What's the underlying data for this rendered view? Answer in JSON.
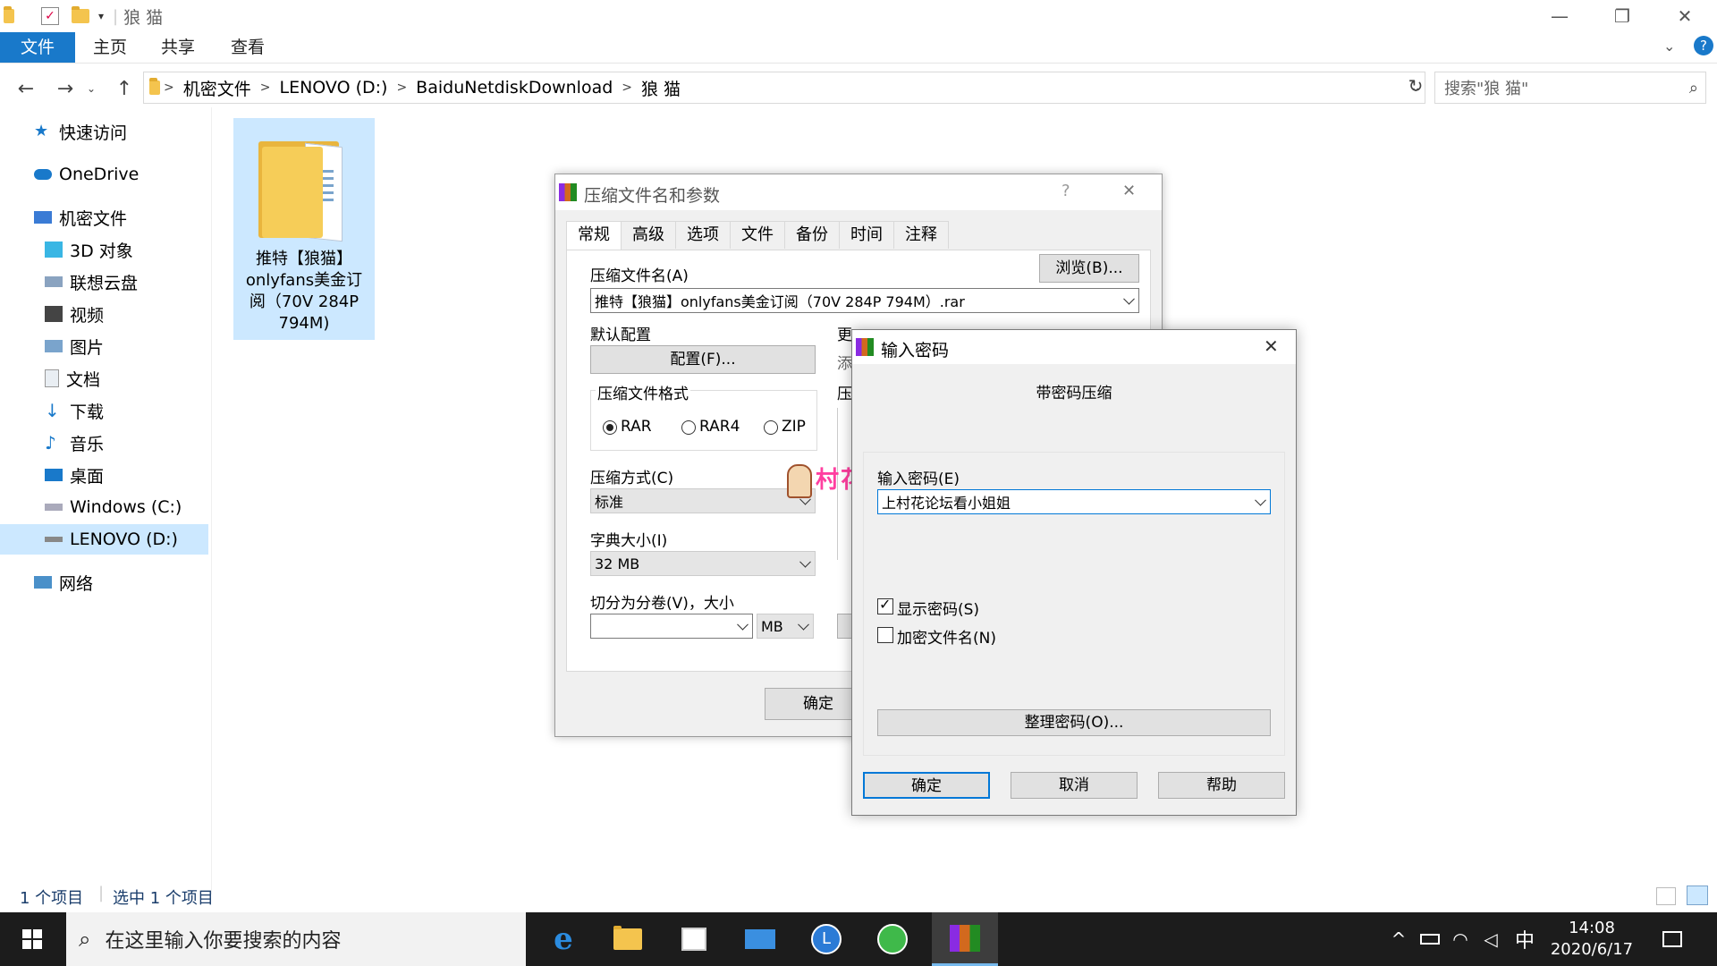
{
  "window": {
    "title": "狼 猫",
    "minimize": "—",
    "maximize": "❐",
    "close": "✕"
  },
  "ribbon": {
    "tabs": [
      "文件",
      "主页",
      "共享",
      "查看"
    ]
  },
  "address": {
    "crumbs": [
      "机密文件",
      "LENOVO (D:)",
      "BaiduNetdiskDownload",
      "狼 猫"
    ],
    "search_placeholder": "搜索\"狼 猫\""
  },
  "sidebar": {
    "items": [
      {
        "label": "快速访问",
        "icon": "star-icon"
      },
      {
        "label": "OneDrive",
        "icon": "cloud-icon"
      },
      {
        "label": "机密文件",
        "icon": "computer-icon"
      },
      {
        "label": "3D 对象",
        "icon": "cube-icon"
      },
      {
        "label": "联想云盘",
        "icon": "cloud-drive-icon"
      },
      {
        "label": "视频",
        "icon": "video-icon"
      },
      {
        "label": "图片",
        "icon": "picture-icon"
      },
      {
        "label": "文档",
        "icon": "document-icon"
      },
      {
        "label": "下载",
        "icon": "download-icon"
      },
      {
        "label": "音乐",
        "icon": "music-icon"
      },
      {
        "label": "桌面",
        "icon": "desktop-icon"
      },
      {
        "label": "Windows (C:)",
        "icon": "drive-icon"
      },
      {
        "label": "LENOVO (D:)",
        "icon": "drive-icon"
      },
      {
        "label": "网络",
        "icon": "network-icon"
      }
    ]
  },
  "file": {
    "name_lines": [
      "推特【狼猫】",
      "onlyfans美金订",
      "阅（70V 284P",
      "794M)"
    ]
  },
  "status": {
    "count": "1 个项目",
    "selected": "选中 1 个项目"
  },
  "taskbar": {
    "search_placeholder": "在这里输入你要搜索的内容",
    "ime": "中",
    "time": "14:08",
    "date": "2020/6/17"
  },
  "rar": {
    "title": "压缩文件名和参数",
    "help": "?",
    "close": "✕",
    "tabs": [
      "常规",
      "高级",
      "选项",
      "文件",
      "备份",
      "时间",
      "注释"
    ],
    "archive_name_label": "压缩文件名(A)",
    "browse": "浏览(B)...",
    "archive_name": "推特【狼猫】onlyfans美金订阅（70V 284P 794M）.rar",
    "default_profile_label": "默认配置",
    "profiles_button": "配置(F)...",
    "update_label_partial": "更",
    "update_value_partial": "添",
    "format_label": "压缩文件格式",
    "formats": [
      "RAR",
      "RAR4",
      "ZIP"
    ],
    "method_label": "压缩方式(C)",
    "method": "标准",
    "dict_label": "字典大小(I)",
    "dict": "32 MB",
    "split_label": "切分为分卷(V)，大小",
    "split_unit": "MB",
    "options_partial": "压",
    "ok": "确定"
  },
  "pw": {
    "title": "输入密码",
    "close": "✕",
    "subtitle": "带密码压缩",
    "enter_label": "输入密码(E)",
    "password": "上村花论坛看小姐姐",
    "show_password": "显示密码(S)",
    "encrypt_names": "加密文件名(N)",
    "organize": "整理密码(O)...",
    "ok": "确定",
    "cancel": "取消",
    "help": "帮助"
  },
  "watermark": "村花论坛"
}
